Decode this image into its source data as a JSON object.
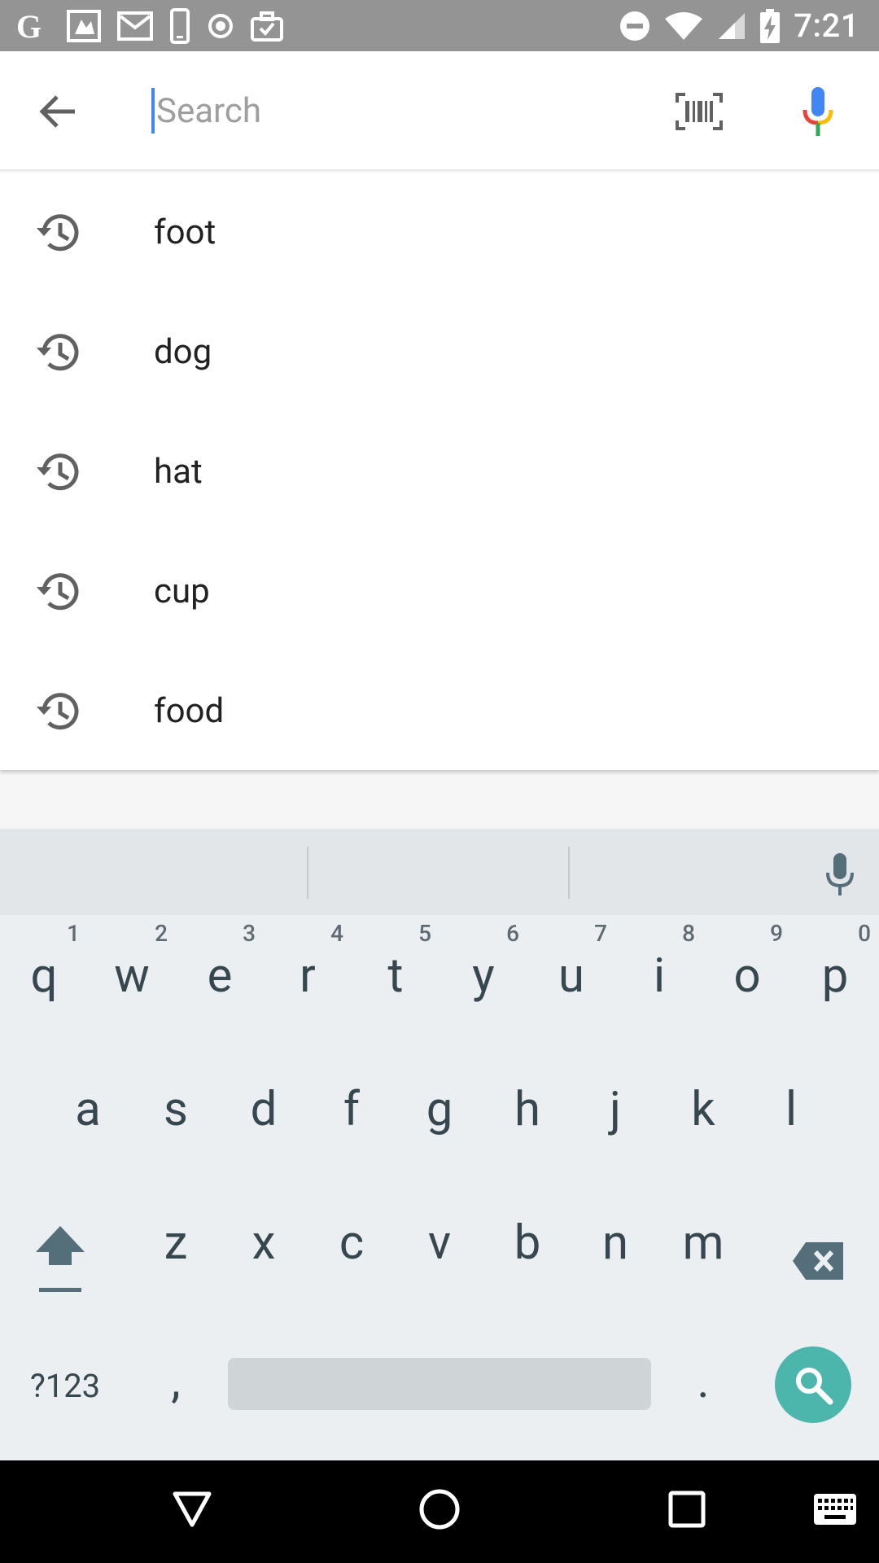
{
  "status_bar": {
    "time": "7:21",
    "left_icons": [
      "google-icon",
      "photos-icon",
      "gmail-icon",
      "phone-icon",
      "target-icon",
      "briefcase-icon"
    ],
    "right_icons": [
      "do-not-disturb-icon",
      "wifi-icon",
      "cell-signal-icon",
      "battery-charging-icon"
    ]
  },
  "search": {
    "placeholder": "Search",
    "value": ""
  },
  "suggestions": [
    {
      "label": "foot"
    },
    {
      "label": "dog"
    },
    {
      "label": "hat"
    },
    {
      "label": "cup"
    },
    {
      "label": "food"
    }
  ],
  "keyboard": {
    "row1": [
      {
        "ch": "q",
        "num": "1"
      },
      {
        "ch": "w",
        "num": "2"
      },
      {
        "ch": "e",
        "num": "3"
      },
      {
        "ch": "r",
        "num": "4"
      },
      {
        "ch": "t",
        "num": "5"
      },
      {
        "ch": "y",
        "num": "6"
      },
      {
        "ch": "u",
        "num": "7"
      },
      {
        "ch": "i",
        "num": "8"
      },
      {
        "ch": "o",
        "num": "9"
      },
      {
        "ch": "p",
        "num": "0"
      }
    ],
    "row2": [
      "a",
      "s",
      "d",
      "f",
      "g",
      "h",
      "j",
      "k",
      "l"
    ],
    "row3": [
      "z",
      "x",
      "c",
      "v",
      "b",
      "n",
      "m"
    ],
    "symbols_label": "?123",
    "comma_label": ",",
    "period_label": "."
  },
  "colors": {
    "accent": "#4285f4",
    "search_key": "#4db6ac",
    "keyboard_bg": "#eceff1"
  }
}
